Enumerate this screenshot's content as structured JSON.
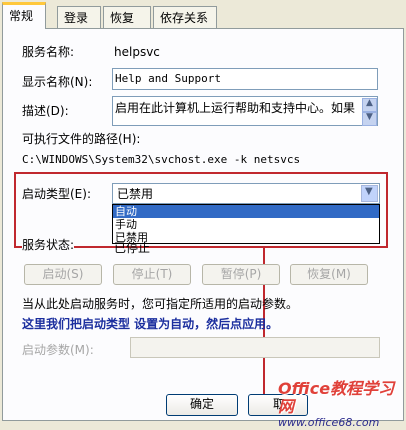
{
  "tabs": [
    "常规",
    "登录",
    "恢复",
    "依存关系"
  ],
  "general": {
    "service_name_label": "服务名称:",
    "service_name_value": "helpsvc",
    "display_name_label": "显示名称(N):",
    "display_name_value": "Help and Support",
    "description_label": "描述(D):",
    "description_value": "启用在此计算机上运行帮助和支持中心。如果",
    "path_label": "可执行文件的路径(H):",
    "path_value": "C:\\WINDOWS\\System32\\svchost.exe -k netsvcs",
    "startup_type_label": "启动类型(E):",
    "startup_type_value": "已禁用",
    "startup_options": [
      "自动",
      "手动",
      "已禁用"
    ],
    "status_label": "服务状态:",
    "status_value": "已停止",
    "buttons": {
      "start": "启动(S)",
      "stop": "停止(T)",
      "pause": "暂停(P)",
      "resume": "恢复(M)"
    },
    "start_param_info": "当从此处启动服务时，您可指定所适用的启动参数。",
    "annotation": "这里我们把启动类型 设置为自动，然后点应用。",
    "start_params_label": "启动参数(M):"
  },
  "footer": {
    "ok": "确定",
    "cancel": "取"
  },
  "watermark": {
    "line1": "Office教程学习网",
    "line2": "www.office68.com"
  },
  "colors": {
    "highlight_box": "#C0282E",
    "selection": "#316AC5",
    "annotation_text": "#1B2E9E"
  }
}
